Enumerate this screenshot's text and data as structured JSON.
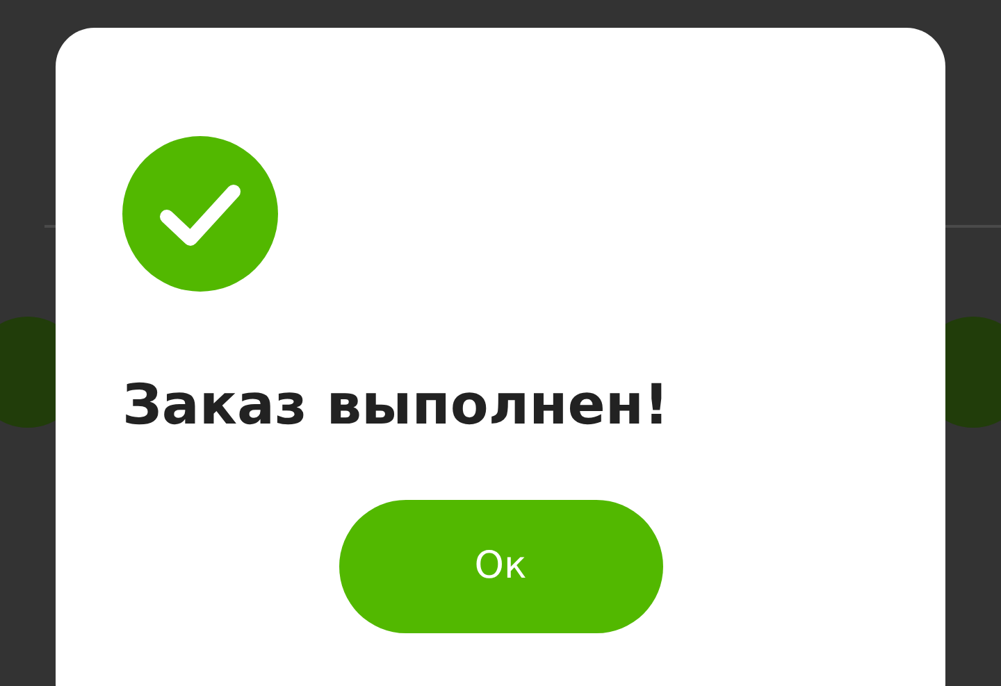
{
  "dialog": {
    "title": "Заказ выполнен!",
    "button": "Ок"
  }
}
